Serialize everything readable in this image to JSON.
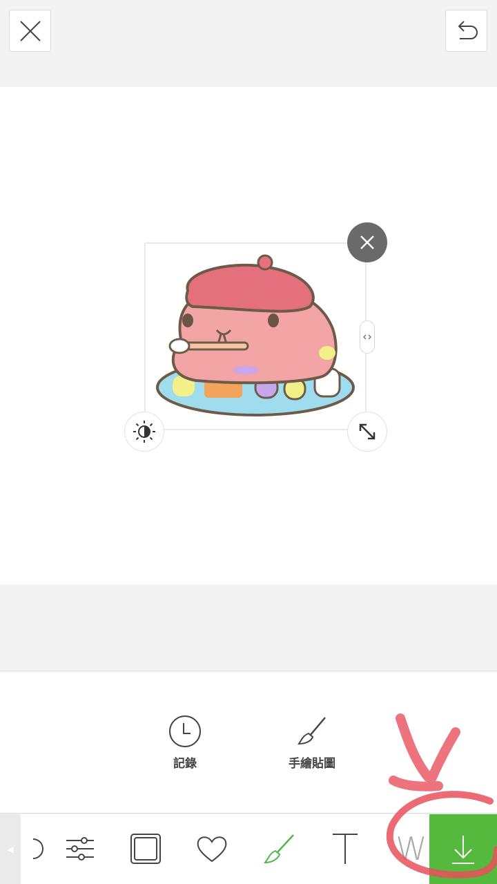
{
  "topbar": {
    "close_icon": "close-icon",
    "undo_icon": "undo-icon"
  },
  "canvas": {
    "sticker": {
      "description_icon": "capybara-painter-sticker",
      "handles": [
        "delete-handle",
        "brightness-handle",
        "resize-handle",
        "stretch-handle"
      ]
    }
  },
  "submenu": {
    "items": [
      {
        "label": "記錄",
        "icon": "clock-icon"
      },
      {
        "label": "手繪貼圖",
        "icon": "paintbrush-icon"
      }
    ]
  },
  "toolbar": {
    "tools": [
      {
        "icon": "sticker-icon"
      },
      {
        "icon": "adjust-sliders-icon"
      },
      {
        "icon": "frame-icon"
      },
      {
        "icon": "heart-icon"
      },
      {
        "icon": "brush-icon",
        "active": true
      },
      {
        "icon": "text-icon",
        "glyph": "T"
      },
      {
        "icon": "handwriting-icon",
        "glyph": "W"
      }
    ],
    "download_icon": "download-icon"
  },
  "colors": {
    "accent_green": "#55b93e",
    "brush_active": "#52b64a",
    "annotation_red": "#e8505b",
    "delete_handle": "#6a6a6a"
  }
}
